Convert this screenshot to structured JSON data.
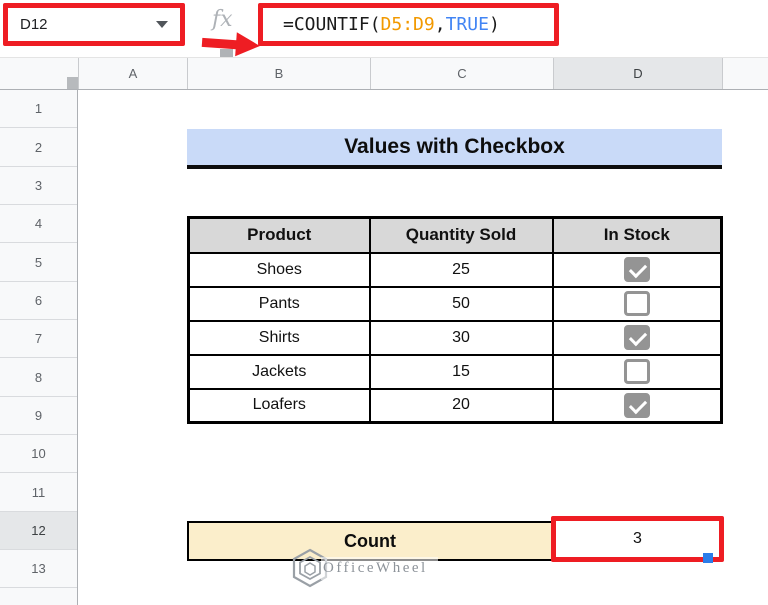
{
  "name_box": {
    "value": "D12"
  },
  "formula_bar": {
    "fx_label": "fx",
    "formula": {
      "open": "=COUNTIF(",
      "range": "D5:D9",
      "comma": ",",
      "boolean": "TRUE",
      "close": ")"
    }
  },
  "grid": {
    "column_headers": [
      "A",
      "B",
      "C",
      "D"
    ],
    "row_headers": [
      "1",
      "2",
      "3",
      "4",
      "5",
      "6",
      "7",
      "8",
      "9",
      "10",
      "11",
      "12",
      "13"
    ],
    "selected_cell": "D12"
  },
  "sheet": {
    "title": "Values with Checkbox",
    "table": {
      "headers": [
        "Product",
        "Quantity Sold",
        "In Stock"
      ],
      "rows": [
        {
          "product": "Shoes",
          "quantity": "25",
          "in_stock": true
        },
        {
          "product": "Pants",
          "quantity": "50",
          "in_stock": false
        },
        {
          "product": "Shirts",
          "quantity": "30",
          "in_stock": true
        },
        {
          "product": "Jackets",
          "quantity": "15",
          "in_stock": false
        },
        {
          "product": "Loafers",
          "quantity": "20",
          "in_stock": true
        }
      ]
    },
    "count_label": "Count",
    "count_value": "3"
  },
  "watermark": {
    "text": "OfficeWheel"
  },
  "colors": {
    "annotation_red": "#ee1d23",
    "title_bg": "#c9daf8",
    "count_bg": "#fbeecb",
    "table_header_bg": "#d8d8d8",
    "formula_range_orange": "#f29900",
    "formula_bool_blue": "#4285f4",
    "checkbox_gray": "#949494",
    "fill_handle_blue": "#2b7de9"
  }
}
